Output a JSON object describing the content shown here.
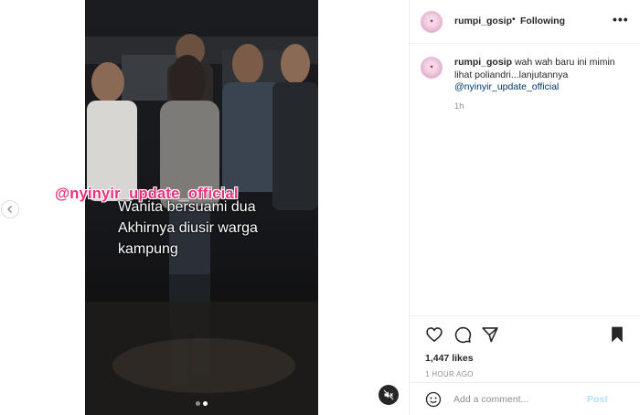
{
  "post": {
    "watermark": "@nyinyir_update_official",
    "caption_lines": [
      "Wanita bersuami dua",
      "Akhirnya diusir warga",
      "kampung"
    ],
    "carousel": {
      "count": 2,
      "active_index": 1
    }
  },
  "header": {
    "username": "rumpi_gosip",
    "separator": "•",
    "follow_status": "Following",
    "more": "•••"
  },
  "caption": {
    "username": "rumpi_gosip",
    "text": "wah wah baru ini mimin lihat poliandri...lanjutannya",
    "mention": "@nyinyir_update_official",
    "time": "1h"
  },
  "stats": {
    "likes": "1,447 likes",
    "posted_ago": "1 HOUR AGO"
  },
  "comment": {
    "placeholder": "Add a comment...",
    "post_label": "Post"
  },
  "icons": {
    "prev": "chevron-left-icon",
    "mute": "speaker-muted-icon",
    "like": "heart-icon",
    "comment": "comment-bubble-icon",
    "share": "paper-plane-icon",
    "save": "bookmark-icon",
    "emoji": "smiley-icon"
  },
  "colors": {
    "watermark": "#e8317a",
    "link": "#00376b",
    "muted_text": "#8e8e8e",
    "post_button_disabled": "#b2dffc"
  }
}
